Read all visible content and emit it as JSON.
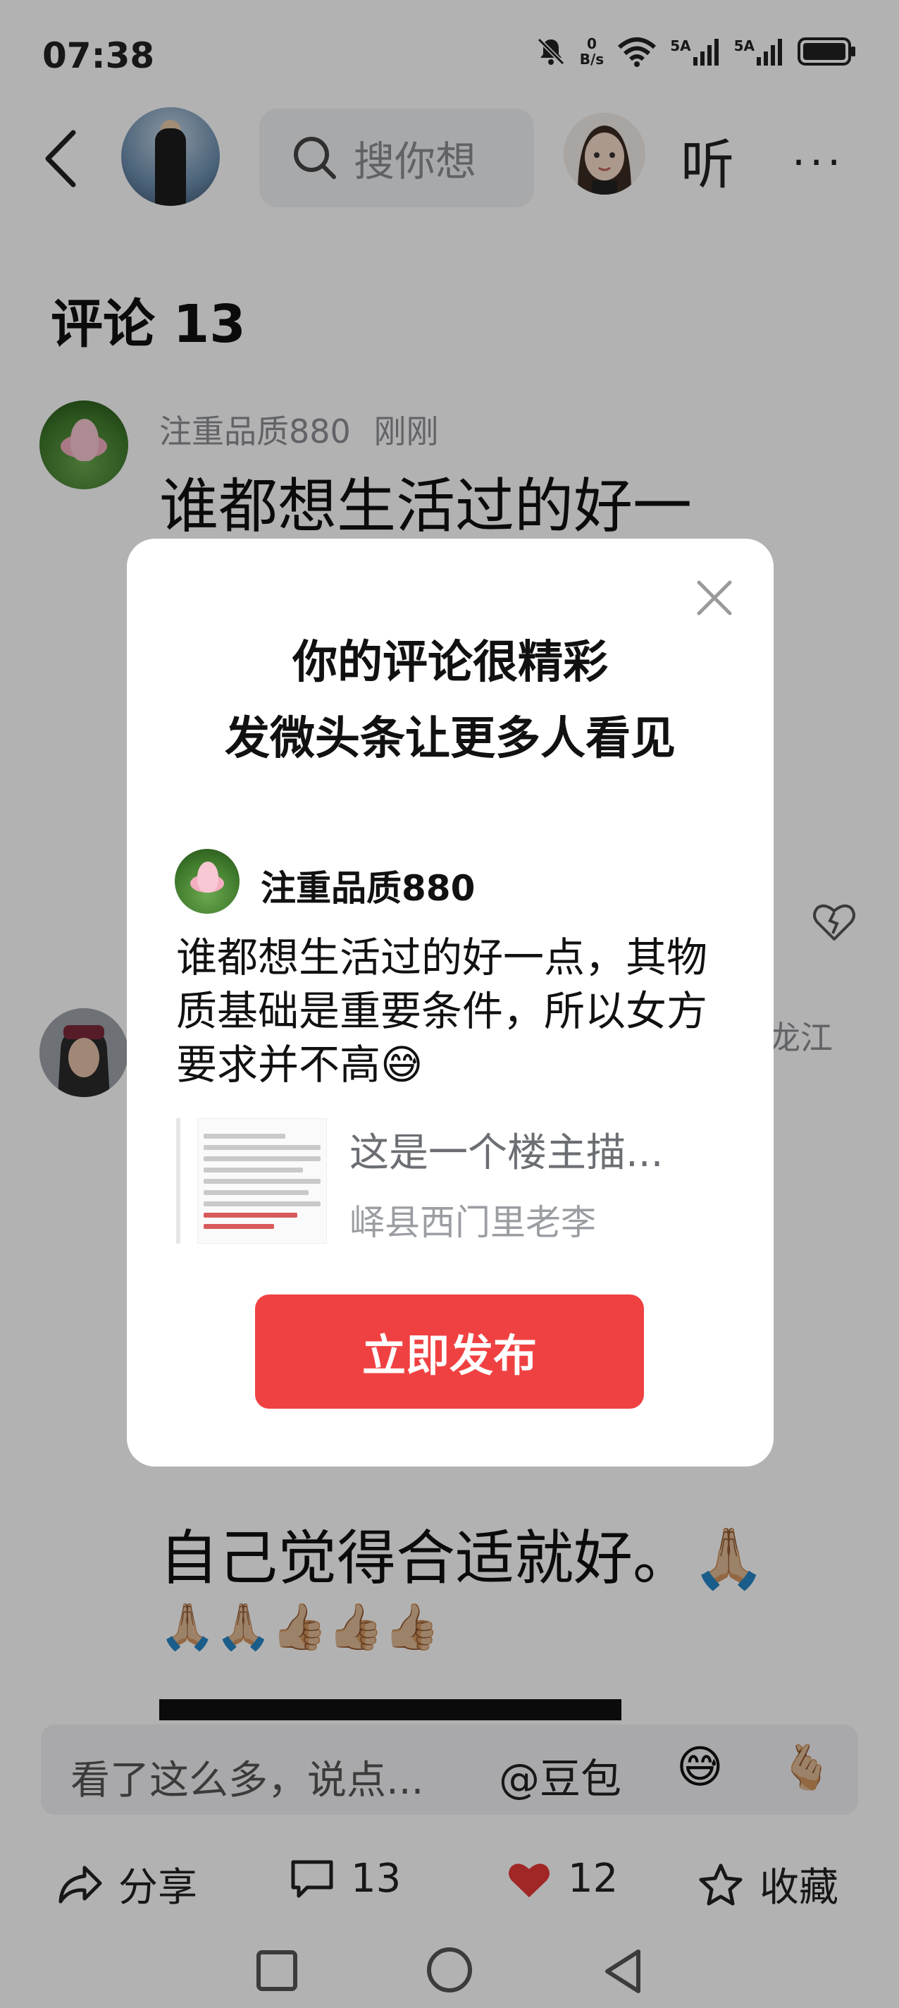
{
  "status": {
    "time": "07:38",
    "net_speed_value": "0",
    "net_speed_unit": "B/s",
    "signal1_label": "5A",
    "signal2_label": "5A"
  },
  "nav": {
    "search_placeholder": "搜你想",
    "listen_label": "听",
    "more_label": "···"
  },
  "comments": {
    "title": "评论 13",
    "items": [
      {
        "user": "注重品质880",
        "time": "刚刚",
        "text": "谁都想生活过的好一"
      },
      {
        "user_fragment": "龙江",
        "text": "自己觉得合适就好。🙏🏼",
        "emoji_row": "🙏🏼🙏🏼👍🏼👍🏼👍🏼"
      }
    ]
  },
  "input": {
    "placeholder": "看了这么多，说点...",
    "mention": "@豆包",
    "emoji_icon": "😅",
    "gift_icon": "🫰🏼"
  },
  "actions": {
    "share_label": "分享",
    "comment_count": "13",
    "like_count": "12",
    "fav_label": "收藏"
  },
  "modal": {
    "title_line1": "你的评论很精彩",
    "title_line2": "发微头条让更多人看见",
    "user": "注重品质880",
    "body": "谁都想生活过的好一点，其物质基础是重要条件，所以女方要求并不高😅",
    "quote_title": "这是一个楼主描...",
    "quote_author": "峄县西门里老李",
    "publish_button": "立即发布"
  },
  "colors": {
    "accent_red": "#f04142",
    "like_red": "#e53935",
    "overlay": "rgba(0,0,0,0.3)"
  }
}
